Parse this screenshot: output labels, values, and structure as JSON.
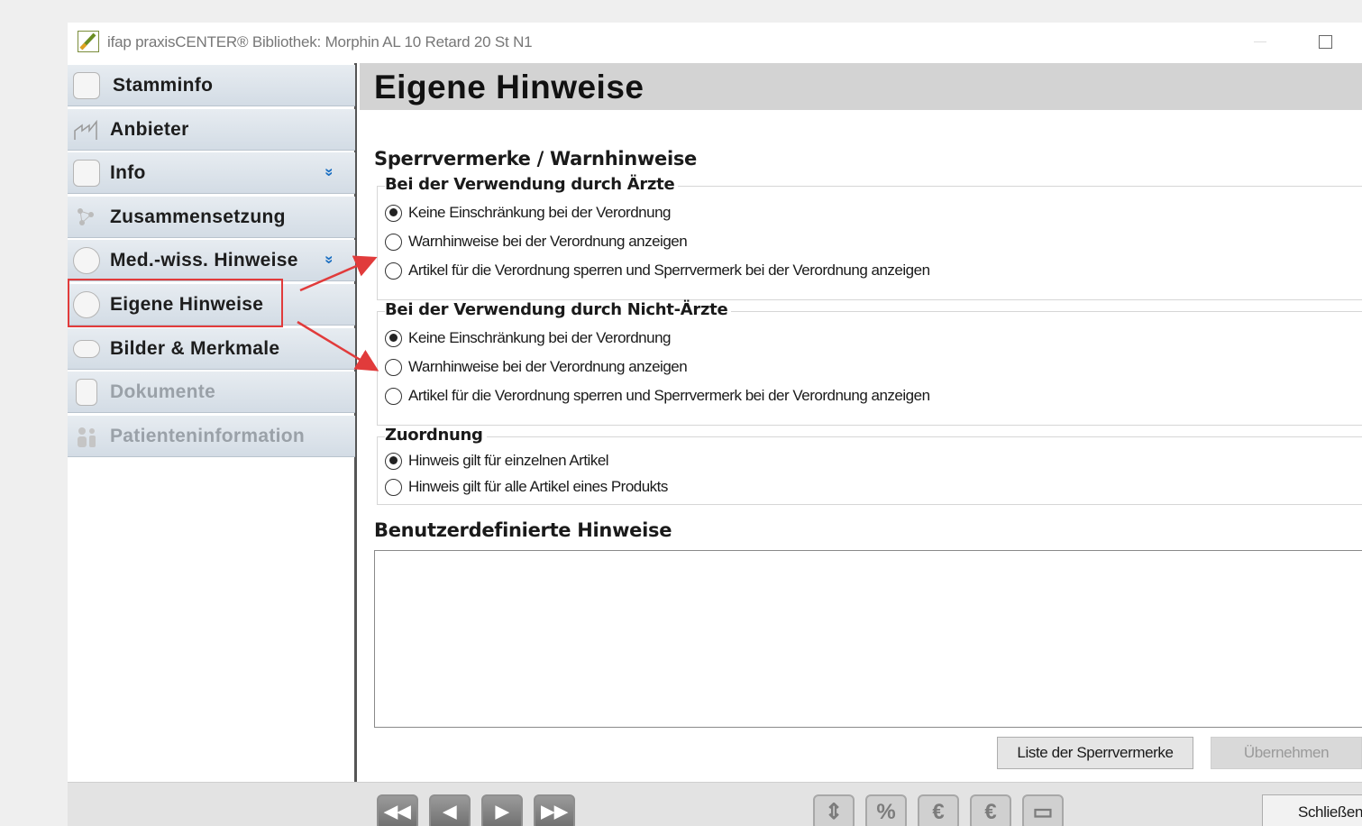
{
  "window": {
    "title": "ifap praxisCENTER® Bibliothek: Morphin AL 10 Retard 20 St N1"
  },
  "sidebar": {
    "items": [
      {
        "label": "Stamminfo",
        "icon": "document-clip-icon",
        "chevron": ""
      },
      {
        "label": "Anbieter",
        "icon": "factory-icon",
        "chevron": ""
      },
      {
        "label": "Info",
        "icon": "info-document-icon",
        "chevron": "»"
      },
      {
        "label": "Zusammensetzung",
        "icon": "molecule-icon",
        "chevron": ""
      },
      {
        "label": "Med.-wiss. Hinweise",
        "icon": "book-icon",
        "chevron": "»"
      },
      {
        "label": "Eigene Hinweise",
        "icon": "stethoscope-icon",
        "chevron": ""
      },
      {
        "label": "Bilder & Merkmale",
        "icon": "pill-icon",
        "chevron": ""
      },
      {
        "label": "Dokumente",
        "icon": "document-icon",
        "chevron": ""
      },
      {
        "label": "Patienteninformation",
        "icon": "patients-icon",
        "chevron": ""
      }
    ],
    "selected": "Eigene Hinweise",
    "highlight_color": "#e13b3b"
  },
  "main": {
    "page_title": "Eigene Hinweise",
    "section_lock": "Sperrvermerke / Warnhinweise",
    "group_doctors": {
      "label": "Bei der Verwendung durch Ärzte",
      "options": [
        "Keine Einschränkung bei der Verordnung",
        "Warnhinweise bei der Verordnung anzeigen",
        "Artikel für die Verordnung sperren und Sperrvermerk bei der Verordnung anzeigen"
      ],
      "selected_index": 0
    },
    "group_nondoctors": {
      "label": "Bei der Verwendung durch Nicht-Ärzte",
      "options": [
        "Keine Einschränkung bei der Verordnung",
        "Warnhinweise bei der Verordnung anzeigen",
        "Artikel für die Verordnung sperren und Sperrvermerk bei der Verordnung anzeigen"
      ],
      "selected_index": 0
    },
    "group_assignment": {
      "label": "Zuordnung",
      "options": [
        "Hinweis gilt für einzelnen Artikel",
        "Hinweis gilt für alle Artikel eines Produkts"
      ],
      "selected_index": 0
    },
    "section_custom": "Benutzerdefinierte Hinweise",
    "custom_notes_value": "",
    "buttons": {
      "list": "Liste der Sperrvermerke",
      "apply": "Übernehmen"
    }
  },
  "footer": {
    "nav_buttons": [
      "◀◀",
      "◀",
      "▶",
      "▶▶"
    ],
    "tool_buttons": [
      "⇕",
      "%",
      "€",
      "€",
      "▭"
    ],
    "close": "Schließen"
  }
}
